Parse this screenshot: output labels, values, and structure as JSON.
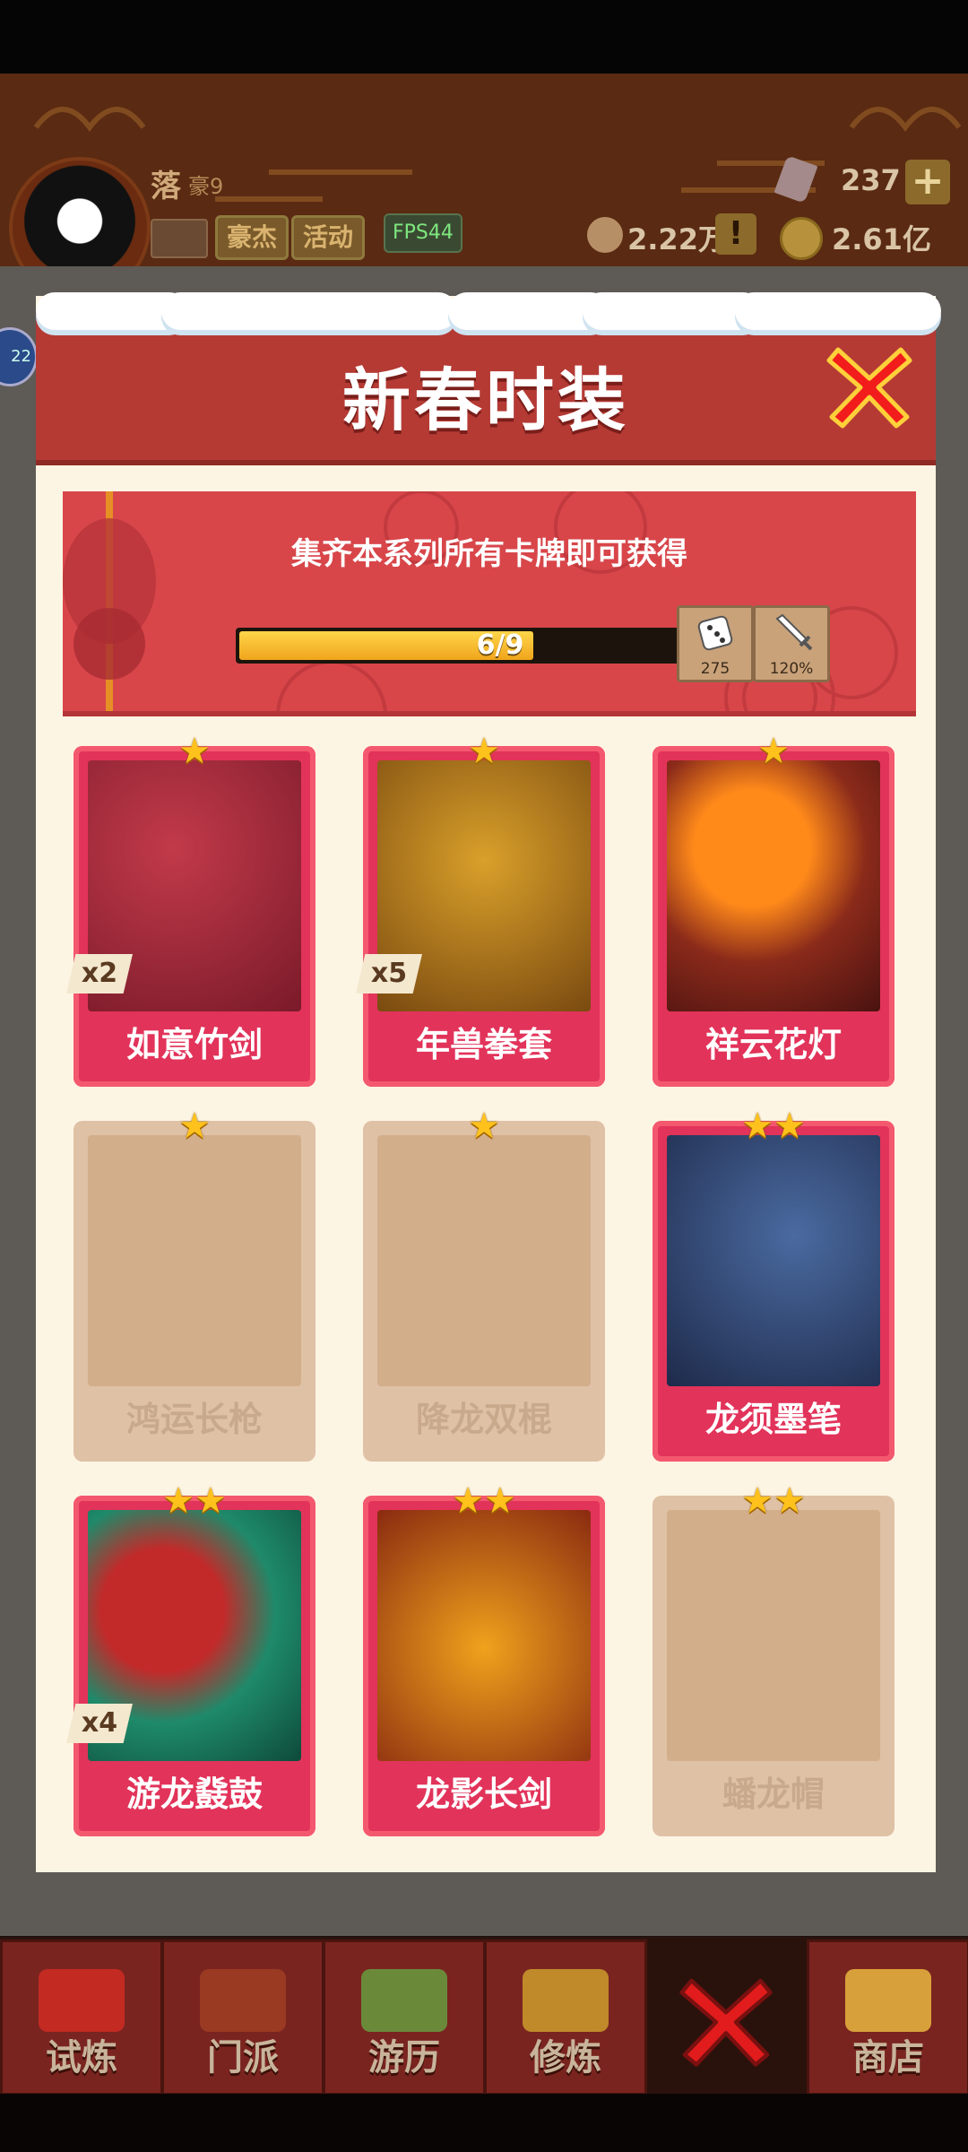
{
  "colors": {
    "accent_red": "#e2335a",
    "header_red": "#b53a34",
    "star": "#ffc21c",
    "progress": "#f0a51c"
  },
  "top_hud": {
    "player_name": "落",
    "player_title": "豪9",
    "tags": [
      "豪杰",
      "活动"
    ],
    "fps": "FPS44",
    "gems": "237",
    "power": "2.22万",
    "coins": "2.61亿",
    "side_badge": "22"
  },
  "modal": {
    "title": "新春时装",
    "close_icon": "close-icon",
    "banner": {
      "text": "集齐本系列所有卡牌即可获得",
      "progress_text": "6/9",
      "progress_fraction": 0.667,
      "bonuses": [
        {
          "icon": "dice-icon",
          "value": "275"
        },
        {
          "icon": "sword-icon",
          "value": "120%"
        }
      ]
    },
    "cards": [
      {
        "name": "如意竹剑",
        "stars": 1,
        "owned": true,
        "count": "x2"
      },
      {
        "name": "年兽拳套",
        "stars": 1,
        "owned": true,
        "count": "x5"
      },
      {
        "name": "祥云花灯",
        "stars": 1,
        "owned": true,
        "count": ""
      },
      {
        "name": "鸿运长枪",
        "stars": 1,
        "owned": false,
        "count": ""
      },
      {
        "name": "降龙双棍",
        "stars": 1,
        "owned": false,
        "count": ""
      },
      {
        "name": "龙须墨笔",
        "stars": 2,
        "owned": true,
        "count": ""
      },
      {
        "name": "游龙鼗鼓",
        "stars": 2,
        "owned": true,
        "count": "x4"
      },
      {
        "name": "龙影长剑",
        "stars": 2,
        "owned": true,
        "count": ""
      },
      {
        "name": "蟠龙帽",
        "stars": 2,
        "owned": false,
        "count": ""
      }
    ]
  },
  "bottom_nav": {
    "items": [
      "试炼",
      "门派",
      "游历",
      "修炼"
    ],
    "shop": "商店"
  }
}
